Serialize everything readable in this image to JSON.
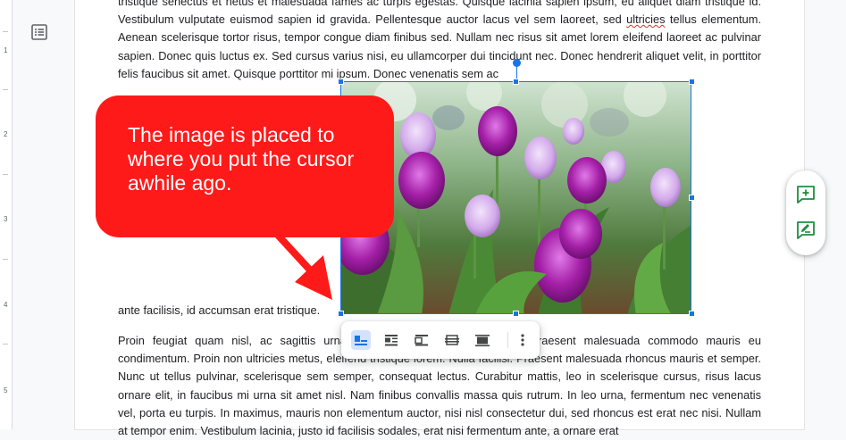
{
  "document": {
    "para_top": "tristique senectus et netus et malesuada fames ac turpis egestas. Quisque lacinia sapien ipsum, eu aliquet diam tristique id. Vestibulum vulputate euismod sapien id gravida. Pellentesque auctor lacus vel sem laoreet, sed ",
    "para_top_spell": "ultricies",
    "para_top_rest": " tellus elementum. Aenean scelerisque tortor risus, tempor congue diam finibus sed. Nullam nec risus sit amet lorem eleifend laoreet ac pulvinar sapien. Donec quis luctus ex. Sed cursus varius nisi, eu ullamcorper dui tincidunt nec. Donec hendrerit aliquet velit, in porttitor felis faucibus sit amet. Quisque porttitor mi ipsum. Donec venenatis sem ac",
    "para_mid": "ante facilisis, id accumsan erat tristique.",
    "para_bottom": "Proin feugiat quam nisl, ac sagittis urna consectetur quis. Nulla facilisi. Praesent malesuada commodo mauris eu condimentum. Proin non ultricies metus, eleifend tristique lorem. Nulla facilisi. Praesent malesuada rhoncus mauris et semper. Nunc ut tellus pulvinar, scelerisque sem semper, consequat lectus. Curabitur mattis, leo in scelerisque cursus, risus lacus ornare elit, in faucibus mi urna sit amet nisl. Nam finibus convallis massa quis rutrum. In leo urna, fermentum nec venenatis vel, porta eu turpis. In maximus, mauris non elementum auctor, nisi nisl consectetur dui, sed rhoncus est erat nec nisi. Nullam at tempor enim. Vestibulum lacinia, justo id facilisis sodales, erat nisi fermentum ante, a ornare erat"
  },
  "callout": {
    "text": "The image is placed to where you put the cursor awhile ago."
  },
  "ruler": {
    "ticks": [
      "1",
      "2",
      "3",
      "4",
      "5"
    ]
  },
  "image_toolbar": {
    "buttons": [
      "inline-icon",
      "wrap-text-icon",
      "break-text-icon",
      "behind-text-icon",
      "in-front-of-text-icon",
      "more-options-icon"
    ],
    "active": "inline-icon"
  },
  "side_panel": {
    "buttons": [
      "add-comment-icon",
      "suggest-edits-icon"
    ]
  },
  "colors": {
    "accent": "#1a73e8",
    "callout": "#ff1a1a",
    "comment_icon": "#1e8e3e"
  }
}
